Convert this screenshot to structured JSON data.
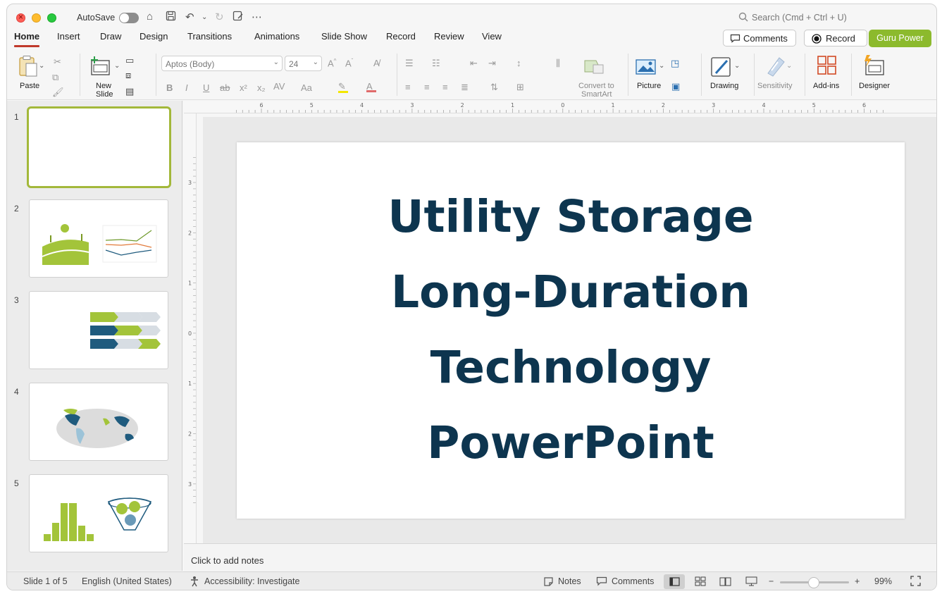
{
  "titlebar": {
    "autosave_label": "AutoSave",
    "search_placeholder": "Search (Cmd + Ctrl + U)"
  },
  "tabs": [
    {
      "label": "Home",
      "active": true
    },
    {
      "label": "Insert"
    },
    {
      "label": "Draw"
    },
    {
      "label": "Design"
    },
    {
      "label": "Transitions"
    },
    {
      "label": "Animations"
    },
    {
      "label": "Slide Show"
    },
    {
      "label": "Record"
    },
    {
      "label": "Review"
    },
    {
      "label": "View"
    }
  ],
  "header_buttons": {
    "comments": "Comments",
    "record": "Record",
    "guru_power": "Guru Power"
  },
  "ribbon": {
    "paste": "Paste",
    "new_slide_1": "New",
    "new_slide_2": "Slide",
    "font_name": "Aptos (Body)",
    "font_size": "24",
    "convert_1": "Convert to",
    "convert_2": "SmartArt",
    "picture": "Picture",
    "drawing": "Drawing",
    "sensitivity": "Sensitivity",
    "add_ins": "Add-ins",
    "designer": "Designer"
  },
  "thumbnails": [
    {
      "number": "1"
    },
    {
      "number": "2"
    },
    {
      "number": "3"
    },
    {
      "number": "4"
    },
    {
      "number": "5"
    }
  ],
  "ruler": {
    "h_ticks": [
      "6",
      "5",
      "4",
      "3",
      "2",
      "1",
      "0",
      "1",
      "2",
      "3",
      "4",
      "5",
      "6"
    ],
    "v_ticks": [
      "3",
      "2",
      "1",
      "0",
      "1",
      "2",
      "3"
    ]
  },
  "slide": {
    "title_lines": [
      "Utility Storage",
      "Long-Duration",
      "Technology",
      "PowerPoint"
    ],
    "title_color": "#0d354f"
  },
  "notes_placeholder": "Click to add notes",
  "status": {
    "slide_count": "Slide 1 of 5",
    "language": "English (United States)",
    "accessibility": "Accessibility: Investigate",
    "notes": "Notes",
    "comments": "Comments",
    "zoom": "99%"
  },
  "colors": {
    "accent": "#c0392b",
    "guru": "#8cba2d",
    "thumb_green": "#a3c43a",
    "thumb_blue": "#1f5b7e"
  }
}
